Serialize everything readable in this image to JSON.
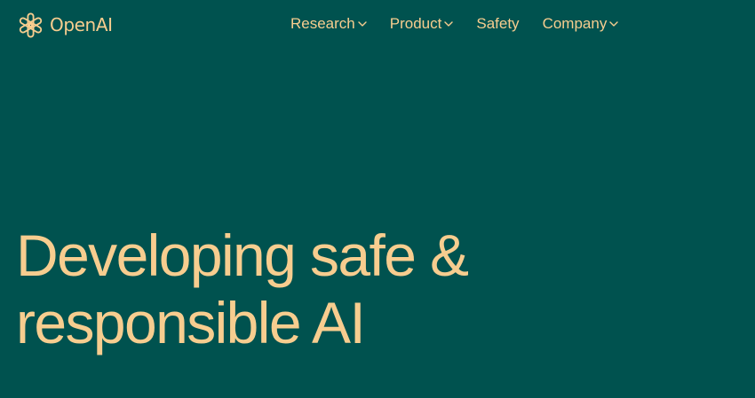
{
  "colors": {
    "background": "#00524f",
    "accent": "#f7cd8f"
  },
  "header": {
    "logo_icon": "openai-knot-icon",
    "brand": "OpenAI",
    "nav": [
      {
        "label": "Research",
        "icon": "chevron-down-icon"
      },
      {
        "label": "Product",
        "icon": "chevron-down-icon"
      },
      {
        "label": "Safety"
      },
      {
        "label": "Company",
        "icon": "chevron-down-icon"
      }
    ]
  },
  "hero": {
    "title_line_1": "Developing safe &",
    "title_line_2": "responsible AI"
  }
}
